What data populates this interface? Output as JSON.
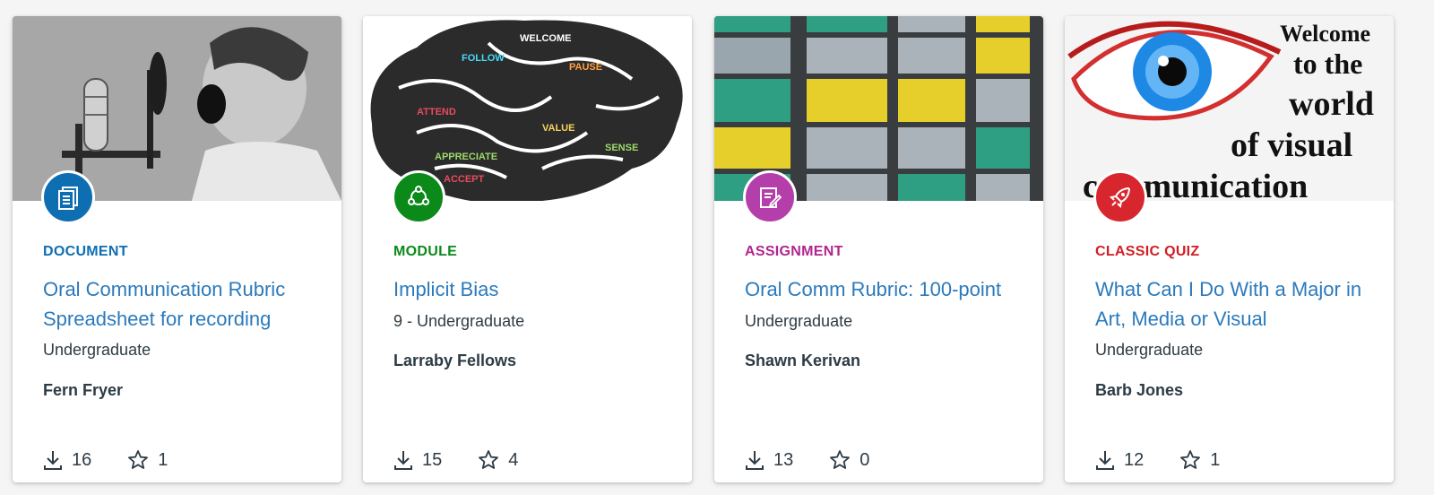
{
  "cards": [
    {
      "type": "DOCUMENT",
      "type_color": "#0e6eb2",
      "badge_color": "#0e6eb2",
      "badge_icon": "document-icon",
      "title": "Oral Communication Rubric Spreadsheet for recording",
      "subtitle": "Undergraduate",
      "author": "Fern Fryer",
      "downloads": "16",
      "favorites": "1",
      "thumbnail": "boy-shouting-into-microphone-image"
    },
    {
      "type": "MODULE",
      "type_color": "#0b8a1a",
      "badge_color": "#0b8a1a",
      "badge_icon": "module-icon",
      "title": "Implicit Bias",
      "subtitle": "9 - Undergraduate",
      "author": "Larraby Fellows",
      "downloads": "15",
      "favorites": "4",
      "thumbnail": "brain-word-collage-image"
    },
    {
      "type": "ASSIGNMENT",
      "type_color": "#b0258e",
      "badge_color": "#b43faa",
      "badge_icon": "assignment-icon",
      "title": "Oral Comm Rubric: 100-point",
      "subtitle": "Undergraduate",
      "author": "Shawn Kerivan",
      "downloads": "13",
      "favorites": "0",
      "thumbnail": "colored-window-panels-image"
    },
    {
      "type": "CLASSIC QUIZ",
      "type_color": "#cf1f25",
      "badge_color": "#d8262e",
      "badge_icon": "rocket-icon",
      "title": "What Can I Do With a Major in Art, Media or Visual",
      "subtitle": "Undergraduate",
      "author": "Barb Jones",
      "downloads": "12",
      "favorites": "1",
      "thumbnail": "eye-visual-communication-image",
      "thumbnail_text": [
        "Welcome",
        "to the",
        "world",
        "of visual",
        "communication"
      ]
    }
  ]
}
